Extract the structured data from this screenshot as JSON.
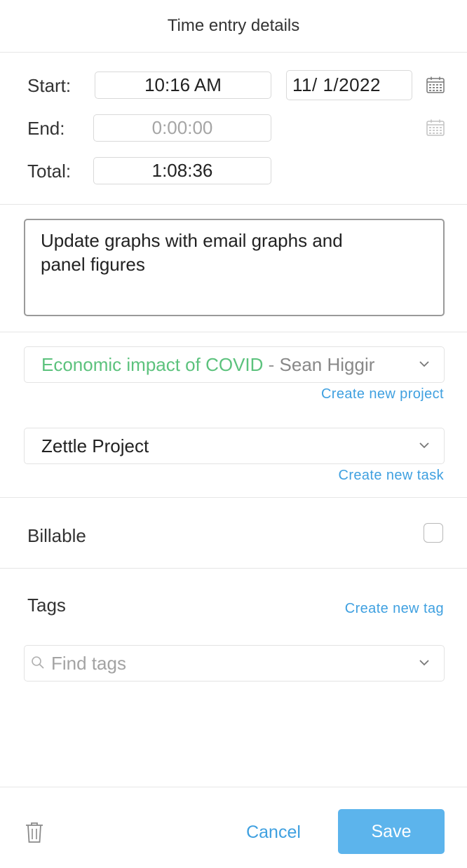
{
  "header": {
    "title": "Time entry details"
  },
  "times": {
    "start_label": "Start:",
    "start_time": "10:16 AM",
    "start_date": "11/  1/2022",
    "end_label": "End:",
    "end_time": "0:00:00",
    "total_label": "Total:",
    "total_time": "1:08:36"
  },
  "description": {
    "line1": "Update graphs with email graphs and",
    "line2": "panel figures"
  },
  "project": {
    "name": "Economic impact of COVID",
    "separator": " - ",
    "client": "Sean Higgir",
    "create_link": "Create new project",
    "name_color": "#5cc27d"
  },
  "task": {
    "name": "Zettle Project",
    "create_link": "Create new task"
  },
  "billable": {
    "label": "Billable",
    "checked": false
  },
  "tags": {
    "label": "Tags",
    "create_link": "Create new tag",
    "placeholder": "Find tags"
  },
  "footer": {
    "cancel_label": "Cancel",
    "save_label": "Save",
    "accent_color": "#3fa0e0"
  },
  "icons": [
    "calendar-icon",
    "chevron-down-icon",
    "search-icon",
    "trash-icon"
  ]
}
